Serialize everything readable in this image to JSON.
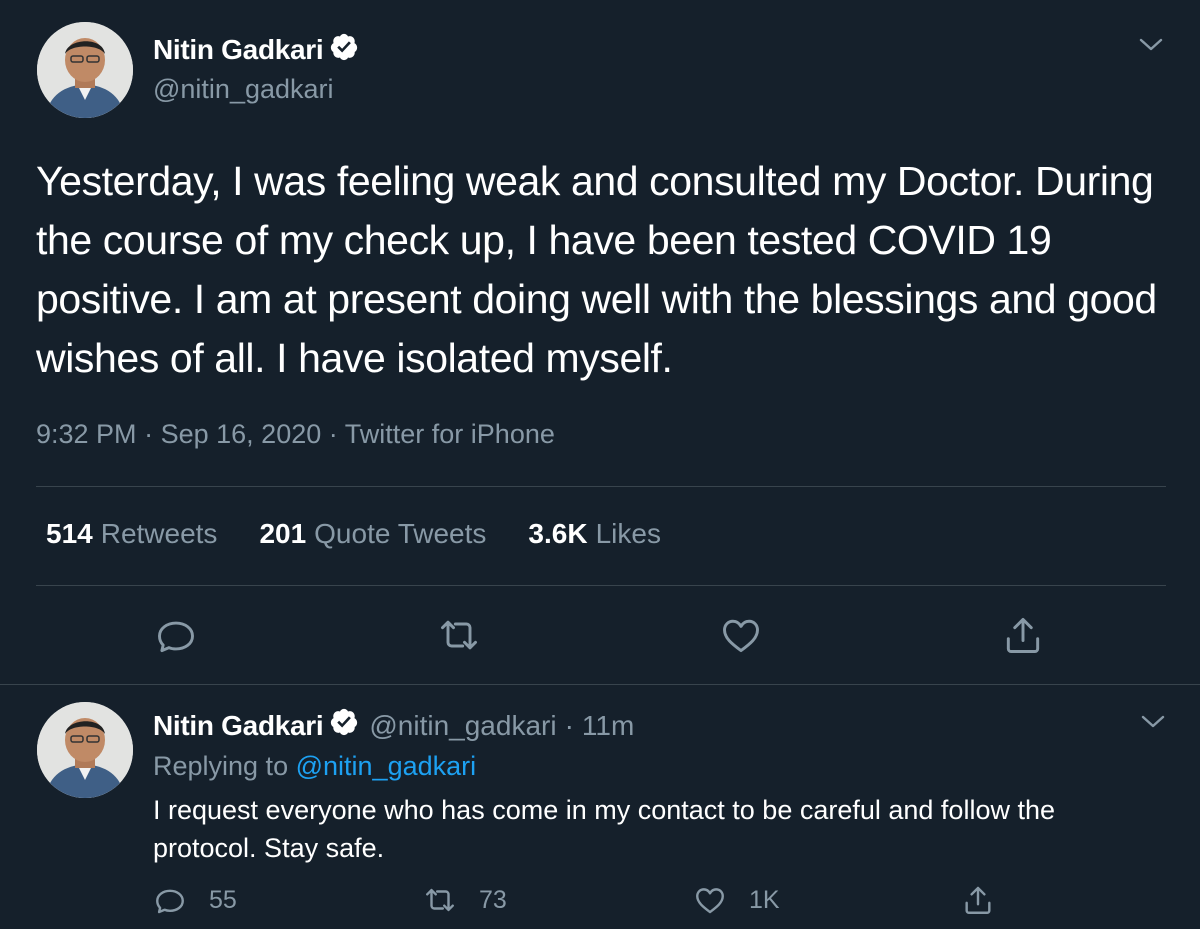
{
  "main_tweet": {
    "author_name": "Nitin Gadkari",
    "handle": "@nitin_gadkari",
    "text": "Yesterday, I was feeling weak and consulted my Doctor. During the course of my check up, I have been tested COVID 19 positive. I am at present doing well with the blessings and good wishes of all. I have isolated myself.",
    "time": "9:32 PM",
    "date": "Sep 16, 2020",
    "source": "Twitter for iPhone",
    "separator": "·",
    "stats": {
      "retweets_count": "514",
      "retweets_label": "Retweets",
      "quotes_count": "201",
      "quotes_label": "Quote Tweets",
      "likes_count": "3.6K",
      "likes_label": "Likes"
    },
    "icons": [
      "reply-icon",
      "retweet-icon",
      "like-icon",
      "share-icon",
      "verified-badge-icon",
      "chevron-down-icon"
    ]
  },
  "reply_tweet": {
    "author_name": "Nitin Gadkari",
    "handle": "@nitin_gadkari",
    "separator": "·",
    "time": "11m",
    "replying_prefix": "Replying to",
    "replying_handle": "@nitin_gadkari",
    "text": "I request everyone who has come in my contact to be careful and follow the protocol. Stay safe.",
    "replies": "55",
    "retweets": "73",
    "likes": "1K"
  },
  "colors": {
    "background": "#15202b",
    "text_primary": "#ffffff",
    "text_secondary": "#8899a6",
    "link": "#1da1f2",
    "divider": "#38444d"
  }
}
